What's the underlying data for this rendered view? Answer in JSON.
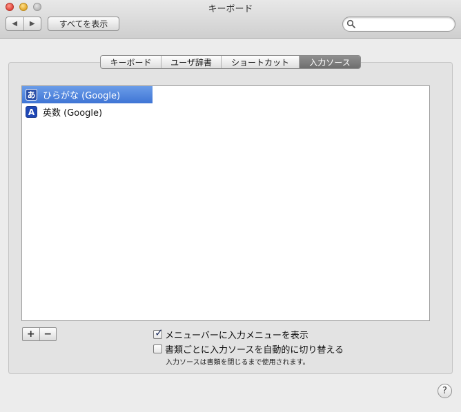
{
  "window": {
    "title": "キーボード",
    "show_all_label": "すべてを表示",
    "search_placeholder": ""
  },
  "tabs": [
    {
      "label": "キーボード",
      "active": false
    },
    {
      "label": "ユーザ辞書",
      "active": false
    },
    {
      "label": "ショートカット",
      "active": false
    },
    {
      "label": "入力ソース",
      "active": true
    }
  ],
  "input_sources": [
    {
      "label": "ひらがな (Google)",
      "icon": "あ",
      "selected": true
    },
    {
      "label": "英数 (Google)",
      "icon": "A",
      "selected": false
    }
  ],
  "controls": {
    "add_label": "+",
    "remove_label": "−"
  },
  "options": {
    "show_menu": {
      "label": "メニューバーに入力メニューを表示",
      "checked": true
    },
    "auto_switch": {
      "label": "書類ごとに入力ソースを自動的に切り替える",
      "checked": false
    },
    "note": "入力ソースは書類を閉じるまで使用されます。"
  },
  "help_label": "?"
}
